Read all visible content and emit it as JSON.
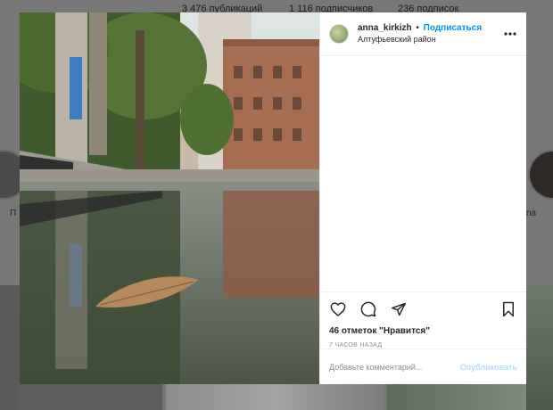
{
  "background_profile": {
    "stats": [
      "3 476 публикаций",
      "1 116 подписчиков",
      "236 подписок"
    ],
    "highlight_label_left": "П",
    "highlight_label_right": "na"
  },
  "post": {
    "username": "anna_kirkizh",
    "separator": "•",
    "follow_label": "Подписаться",
    "location": "Алтуфьевский район",
    "more_icon": "more-horizontal-icon",
    "likes_text": "46 отметок \"Нравится\"",
    "time_text": "7 ЧАСОВ НАЗАД",
    "comment_placeholder": "Добавьте комментарий...",
    "publish_label": "Опубликовать",
    "icons": [
      "heart-icon",
      "comment-icon",
      "share-icon",
      "bookmark-icon"
    ]
  },
  "colors": {
    "accent": "#0095f6",
    "publish_disabled": "#b3dbff",
    "overlay": "#777777"
  }
}
